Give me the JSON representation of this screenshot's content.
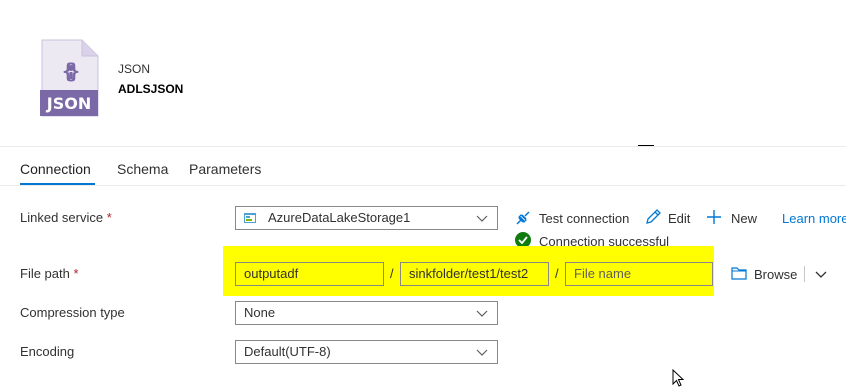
{
  "dataset": {
    "icon_label": "JSON",
    "type": "JSON",
    "name": "ADLSJSON"
  },
  "tabs": [
    {
      "label": "Connection",
      "active": true
    },
    {
      "label": "Schema",
      "active": false
    },
    {
      "label": "Parameters",
      "active": false
    }
  ],
  "linked_service": {
    "label": "Linked service",
    "required_mark": "*",
    "value": "AzureDataLakeStorage1",
    "actions": {
      "test_connection": "Test connection",
      "edit": "Edit",
      "new": "New",
      "learn_more": "Learn more"
    },
    "status": "Connection successful"
  },
  "file_path": {
    "label": "File path",
    "required_mark": "*",
    "container": "outputadf",
    "directory": "sinkfolder/test1/test2",
    "file_placeholder": "File name",
    "separator": "/",
    "browse": "Browse"
  },
  "compression": {
    "label": "Compression type",
    "value": "None"
  },
  "encoding": {
    "label": "Encoding",
    "value": "Default(UTF-8)"
  },
  "colors": {
    "accent": "#0078d4",
    "icon_purple": "#7b68a6",
    "success": "#107c10",
    "highlight": "#ffff00",
    "required": "#a4262c"
  }
}
